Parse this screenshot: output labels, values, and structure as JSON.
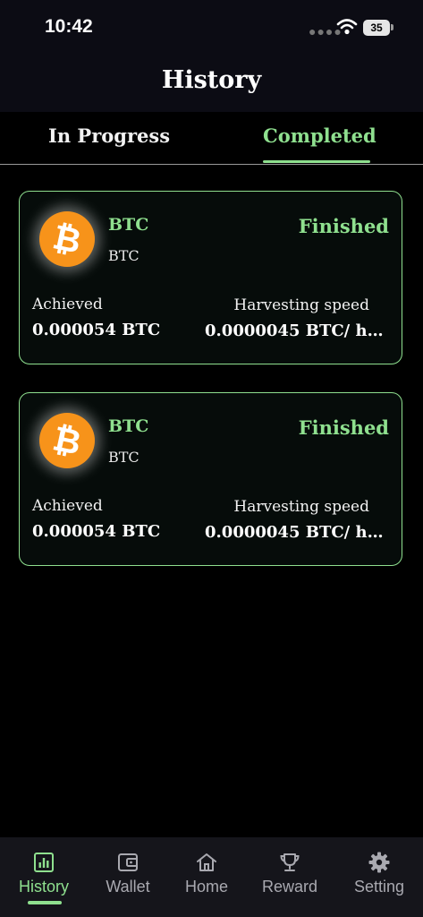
{
  "status_bar": {
    "time": "10:42",
    "battery": "35"
  },
  "header": {
    "title": "History"
  },
  "tabs": [
    {
      "label": "In Progress",
      "active": false
    },
    {
      "label": "Completed",
      "active": true
    }
  ],
  "cards": [
    {
      "coin": "BTC",
      "symbol": "BTC",
      "status": "Finished",
      "achieved_label": "Achieved",
      "achieved_value": "0.000054 BTC",
      "speed_label": "Harvesting speed",
      "speed_value": "0.0000045 BTC/ h..."
    },
    {
      "coin": "BTC",
      "symbol": "BTC",
      "status": "Finished",
      "achieved_label": "Achieved",
      "achieved_value": "0.000054 BTC",
      "speed_label": "Harvesting speed",
      "speed_value": "0.0000045 BTC/ h..."
    }
  ],
  "nav": [
    {
      "label": "History",
      "icon": "bar-chart-icon",
      "active": true
    },
    {
      "label": "Wallet",
      "icon": "wallet-icon",
      "active": false
    },
    {
      "label": "Home",
      "icon": "home-icon",
      "active": false
    },
    {
      "label": "Reward",
      "icon": "trophy-icon",
      "active": false
    },
    {
      "label": "Setting",
      "icon": "gear-icon",
      "active": false
    }
  ],
  "colors": {
    "accent": "#8fe08f",
    "bitcoin": "#f7931a",
    "background": "#000000",
    "header": "#0c0c14"
  }
}
